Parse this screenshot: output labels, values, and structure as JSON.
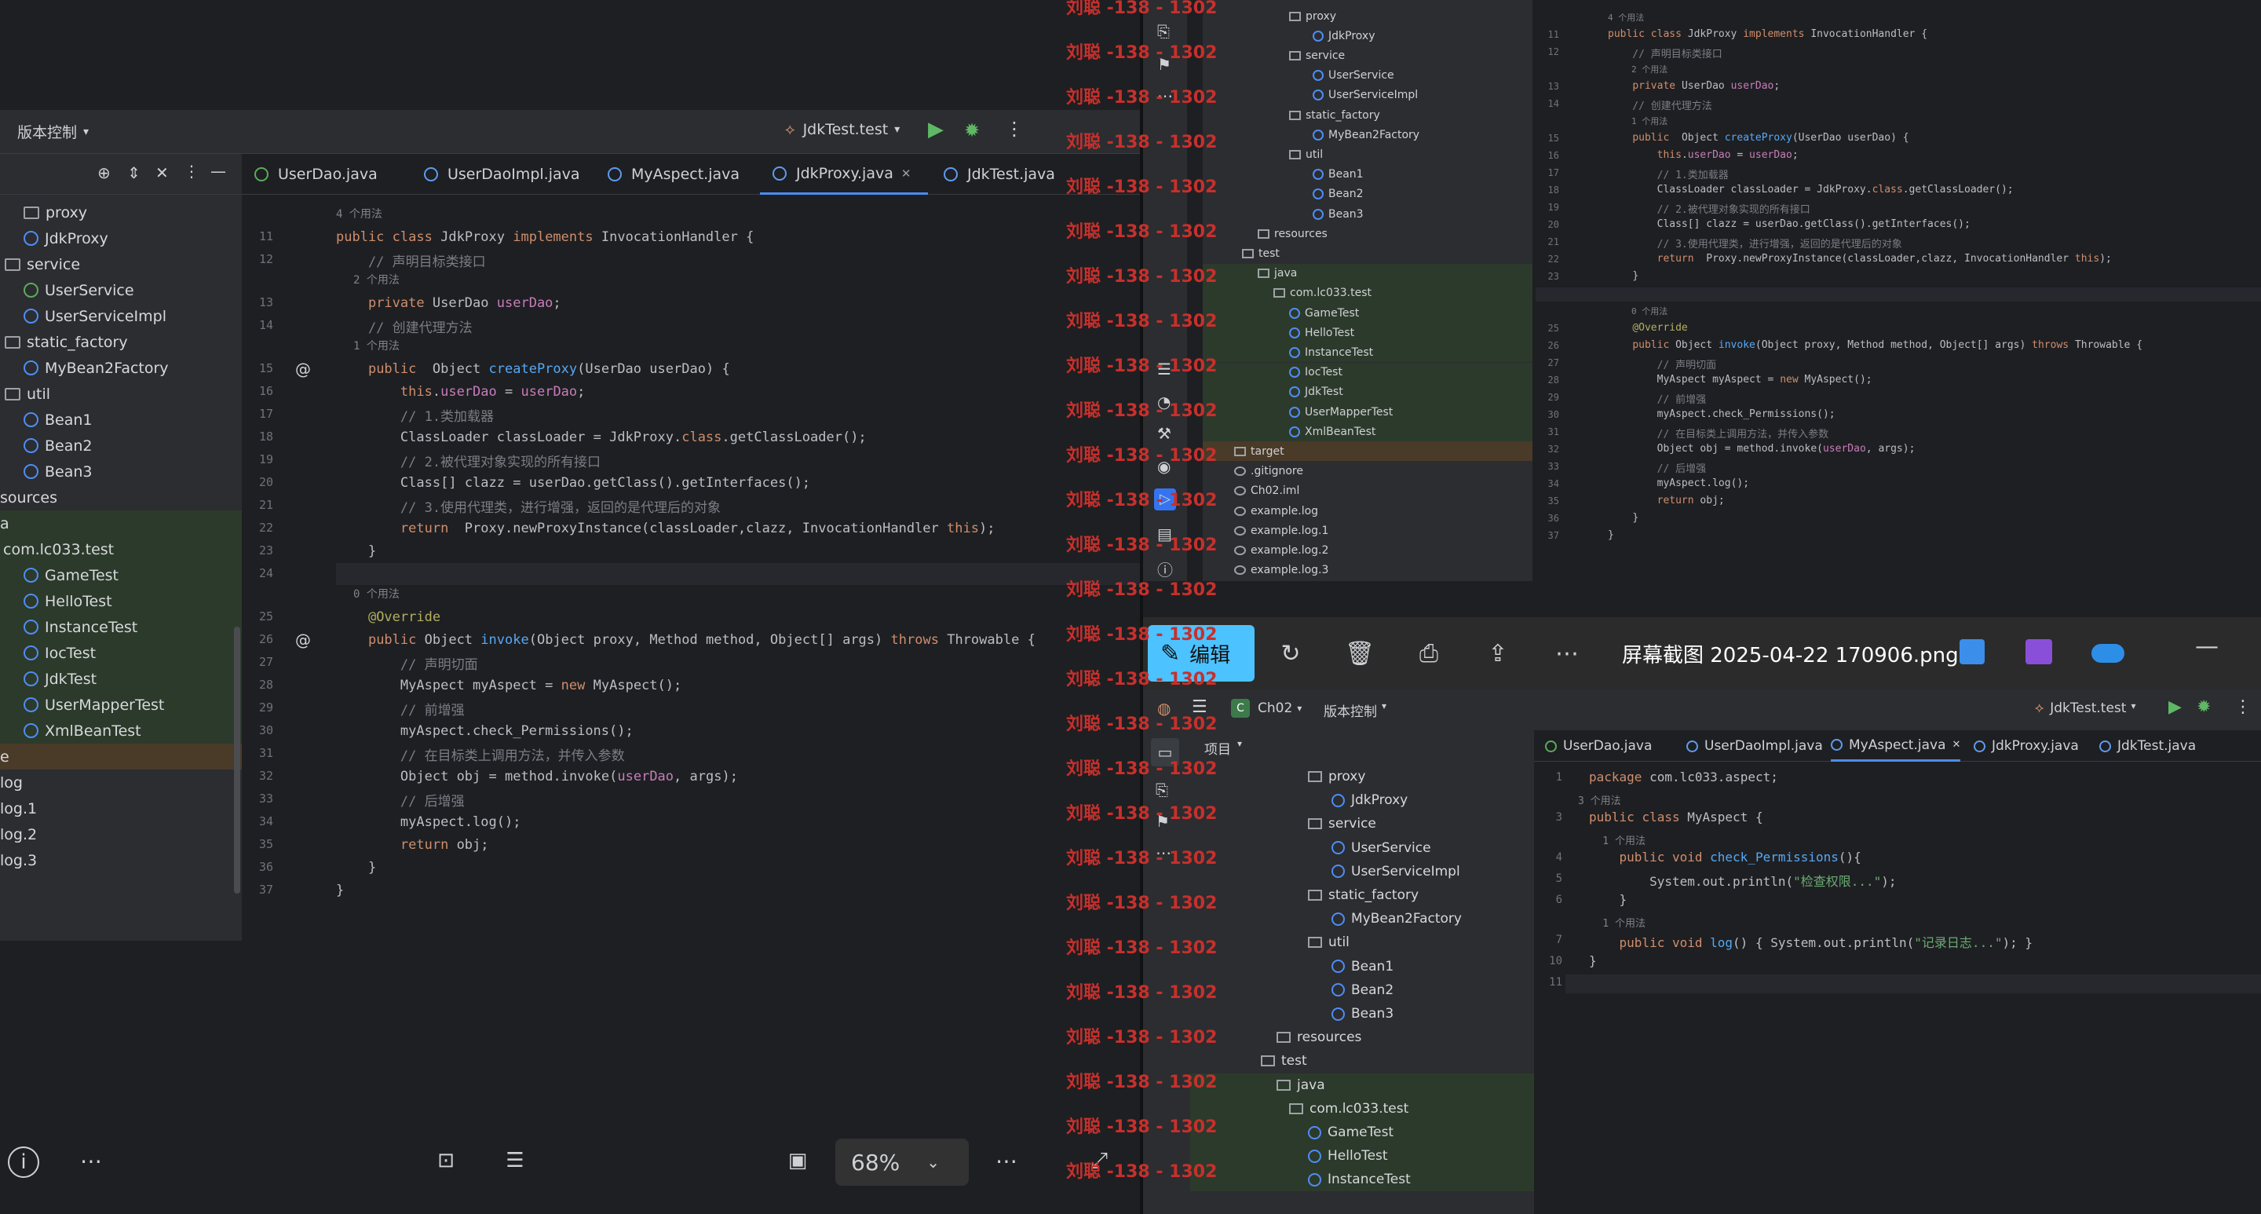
{
  "watermark": {
    "text": "刘聪 -138 - 1302"
  },
  "left": {
    "toolbar": {
      "vcs_label": "版本控制",
      "run_config": "JdkTest.test"
    },
    "tabs": [
      "UserDao.java",
      "UserDaoImpl.java",
      "MyAspect.java",
      "JdkProxy.java",
      "JdkTest.java"
    ],
    "tree": [
      {
        "label": "proxy",
        "kind": "folder"
      },
      {
        "label": "JdkProxy",
        "kind": "class"
      },
      {
        "label": "service",
        "kind": "folder"
      },
      {
        "label": "UserService",
        "kind": "interface"
      },
      {
        "label": "UserServiceImpl",
        "kind": "class"
      },
      {
        "label": "static_factory",
        "kind": "folder"
      },
      {
        "label": "MyBean2Factory",
        "kind": "class"
      },
      {
        "label": "util",
        "kind": "folder"
      },
      {
        "label": "Bean1",
        "kind": "class"
      },
      {
        "label": "Bean2",
        "kind": "class"
      },
      {
        "label": "Bean3",
        "kind": "class"
      },
      {
        "label": "sources",
        "kind": "text"
      },
      {
        "label": "a",
        "kind": "text"
      },
      {
        "label": "com.lc033.test",
        "kind": "text"
      },
      {
        "label": "GameTest",
        "kind": "class"
      },
      {
        "label": "HelloTest",
        "kind": "class"
      },
      {
        "label": "InstanceTest",
        "kind": "class"
      },
      {
        "label": "IocTest",
        "kind": "class"
      },
      {
        "label": "JdkTest",
        "kind": "class"
      },
      {
        "label": "UserMapperTest",
        "kind": "class"
      },
      {
        "label": "XmlBeanTest",
        "kind": "class"
      },
      {
        "label": "e",
        "kind": "text"
      },
      {
        "label": "log",
        "kind": "text"
      },
      {
        "label": "log.1",
        "kind": "text"
      },
      {
        "label": "log.2",
        "kind": "text"
      },
      {
        "label": "log.3",
        "kind": "text"
      }
    ],
    "zoom": "68%"
  },
  "code_jdkproxy": {
    "hint_4": "4 个用法",
    "hint_2": "2 个用法",
    "hint_1": "1 个用法",
    "hint_0": "0 个用法",
    "lines": [
      {
        "n": "11",
        "t": "public class JdkProxy implements InvocationHandler {"
      },
      {
        "n": "12",
        "t": "    // 声明目标类接口"
      },
      {
        "n": "13",
        "t": "    private UserDao userDao;"
      },
      {
        "n": "14",
        "t": "    // 创建代理方法"
      },
      {
        "n": "15",
        "t": "    public  Object createProxy(UserDao userDao) {"
      },
      {
        "n": "16",
        "t": "        this.userDao = userDao;"
      },
      {
        "n": "17",
        "t": "        // 1.类加载器"
      },
      {
        "n": "18",
        "t": "        ClassLoader classLoader = JdkProxy.class.getClassLoader();"
      },
      {
        "n": "19",
        "t": "        // 2.被代理对象实现的所有接口"
      },
      {
        "n": "20",
        "t": "        Class[] clazz = userDao.getClass().getInterfaces();"
      },
      {
        "n": "21",
        "t": "        // 3.使用代理类，进行增强，返回的是代理后的对象"
      },
      {
        "n": "22",
        "t": "        return  Proxy.newProxyInstance(classLoader,clazz, InvocationHandler this);"
      },
      {
        "n": "23",
        "t": "    }"
      },
      {
        "n": "24",
        "t": ""
      },
      {
        "n": "25",
        "t": "    @Override"
      },
      {
        "n": "26",
        "t": "    public Object invoke(Object proxy, Method method, Object[] args) throws Throwable {"
      },
      {
        "n": "27",
        "t": "        // 声明切面"
      },
      {
        "n": "28",
        "t": "        MyAspect myAspect = new MyAspect();"
      },
      {
        "n": "29",
        "t": "        // 前增强"
      },
      {
        "n": "30",
        "t": "        myAspect.check_Permissions();"
      },
      {
        "n": "31",
        "t": "        // 在目标类上调用方法，并传入参数"
      },
      {
        "n": "32",
        "t": "        Object obj = method.invoke(userDao, args);"
      },
      {
        "n": "33",
        "t": "        // 后增强"
      },
      {
        "n": "34",
        "t": "        myAspect.log();"
      },
      {
        "n": "35",
        "t": "        return obj;"
      },
      {
        "n": "36",
        "t": "    }"
      },
      {
        "n": "37",
        "t": "}"
      }
    ]
  },
  "right_top_tree": [
    {
      "label": "proxy",
      "kind": "folder"
    },
    {
      "label": "JdkProxy",
      "kind": "class"
    },
    {
      "label": "service",
      "kind": "folder"
    },
    {
      "label": "UserService",
      "kind": "interface"
    },
    {
      "label": "UserServiceImpl",
      "kind": "class"
    },
    {
      "label": "static_factory",
      "kind": "folder"
    },
    {
      "label": "MyBean2Factory",
      "kind": "class"
    },
    {
      "label": "util",
      "kind": "folder"
    },
    {
      "label": "Bean1",
      "kind": "class"
    },
    {
      "label": "Bean2",
      "kind": "class"
    },
    {
      "label": "Bean3",
      "kind": "class"
    },
    {
      "label": "resources",
      "kind": "folder"
    },
    {
      "label": "test",
      "kind": "folder"
    },
    {
      "label": "java",
      "kind": "folder"
    },
    {
      "label": "com.lc033.test",
      "kind": "folder"
    },
    {
      "label": "GameTest",
      "kind": "class"
    },
    {
      "label": "HelloTest",
      "kind": "class"
    },
    {
      "label": "InstanceTest",
      "kind": "class"
    },
    {
      "label": "IocTest",
      "kind": "class"
    },
    {
      "label": "JdkTest",
      "kind": "class"
    },
    {
      "label": "UserMapperTest",
      "kind": "class"
    },
    {
      "label": "XmlBeanTest",
      "kind": "class"
    },
    {
      "label": "target",
      "kind": "folder"
    },
    {
      "label": ".gitignore",
      "kind": "file"
    },
    {
      "label": "Ch02.iml",
      "kind": "file"
    },
    {
      "label": "example.log",
      "kind": "file"
    },
    {
      "label": "example.log.1",
      "kind": "file"
    },
    {
      "label": "example.log.2",
      "kind": "file"
    },
    {
      "label": "example.log.3",
      "kind": "file"
    }
  ],
  "viewer": {
    "edit_label": "编辑",
    "file_title": "屏幕截图 2025-04-22 170906.png"
  },
  "right_bottom": {
    "project": "Ch02",
    "vcs_label": "版本控制",
    "project_label": "项目",
    "run_config": "JdkTest.test",
    "tabs": [
      "UserDao.java",
      "UserDaoImpl.java",
      "MyAspect.java",
      "JdkProxy.java",
      "JdkTest.java"
    ],
    "tree": [
      {
        "label": "proxy",
        "kind": "folder"
      },
      {
        "label": "JdkProxy",
        "kind": "class"
      },
      {
        "label": "service",
        "kind": "folder"
      },
      {
        "label": "UserService",
        "kind": "interface"
      },
      {
        "label": "UserServiceImpl",
        "kind": "class"
      },
      {
        "label": "static_factory",
        "kind": "folder"
      },
      {
        "label": "MyBean2Factory",
        "kind": "class"
      },
      {
        "label": "util",
        "kind": "folder"
      },
      {
        "label": "Bean1",
        "kind": "class"
      },
      {
        "label": "Bean2",
        "kind": "class"
      },
      {
        "label": "Bean3",
        "kind": "class"
      },
      {
        "label": "resources",
        "kind": "folder"
      },
      {
        "label": "test",
        "kind": "folder"
      },
      {
        "label": "java",
        "kind": "folder"
      },
      {
        "label": "com.lc033.test",
        "kind": "folder"
      },
      {
        "label": "GameTest",
        "kind": "class"
      },
      {
        "label": "HelloTest",
        "kind": "class"
      },
      {
        "label": "InstanceTest",
        "kind": "class"
      }
    ],
    "code": [
      {
        "n": "1",
        "t": "package com.lc033.aspect;"
      },
      {
        "n": "",
        "t": "3 个用法",
        "hint": true
      },
      {
        "n": "3",
        "t": "public class MyAspect {"
      },
      {
        "n": "",
        "t": "    1 个用法",
        "hint": true
      },
      {
        "n": "4",
        "t": "    public void check_Permissions(){"
      },
      {
        "n": "5",
        "t": "        System.out.println(\"检查权限...\");"
      },
      {
        "n": "6",
        "t": "    }"
      },
      {
        "n": "",
        "t": "    1 个用法",
        "hint": true
      },
      {
        "n": "7",
        "t": "    public void log() { System.out.println(\"记录日志...\"); }"
      },
      {
        "n": "10",
        "t": "}"
      },
      {
        "n": "11",
        "t": ""
      }
    ]
  }
}
